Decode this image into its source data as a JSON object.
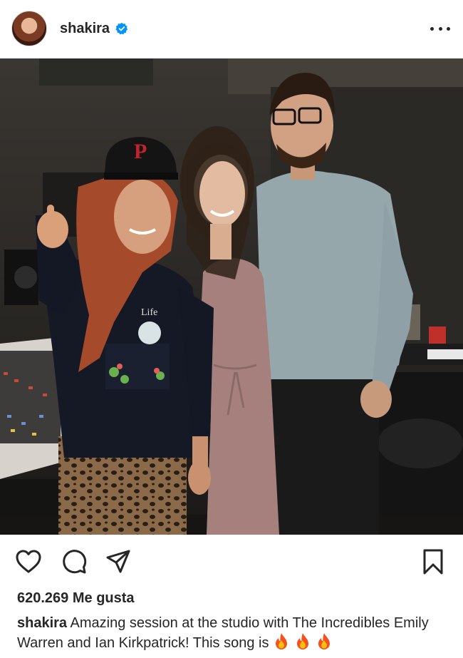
{
  "post": {
    "username": "shakira",
    "verified": true,
    "likes_text": "620.269 Me gusta",
    "caption_user": "shakira",
    "caption_text": "Amazing session at the studio with The Incredibles Emily Warren and Ian Kirkpatrick! This song is",
    "caption_emoji": [
      "fire",
      "fire",
      "fire"
    ]
  },
  "icons": {
    "header": [
      "avatar",
      "verified-badge-icon",
      "more-options-icon"
    ],
    "actions": [
      "heart-icon",
      "comment-icon",
      "share-icon",
      "bookmark-icon"
    ]
  },
  "colors": {
    "verified_blue": "#0095f6",
    "text": "#262626",
    "background": "#ffffff"
  }
}
